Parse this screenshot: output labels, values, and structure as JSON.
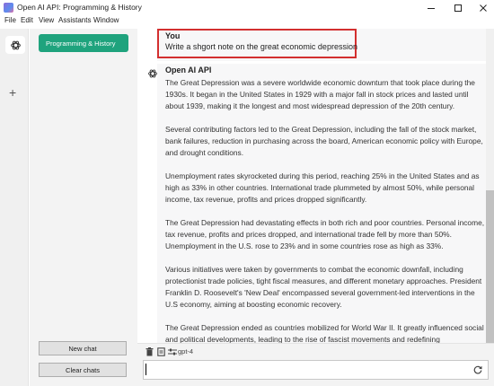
{
  "window": {
    "title": "Open AI API: Programming & History"
  },
  "menu": [
    "File",
    "Edit",
    "View",
    "Assistants",
    "Window"
  ],
  "sidebar": {
    "chats": [
      "Programming & History"
    ],
    "new_chat_label": "New chat",
    "clear_chats_label": "Clear chats"
  },
  "conversation": {
    "user_name": "You",
    "user_message": "Write a shgort note on the great economic depression",
    "assistant_name": "Open AI API",
    "assistant_paragraphs": [
      "The Great Depression was a severe worldwide economic downturn that took place during the 1930s. It began in the United States in 1929 with a major fall in stock prices and lasted until about 1939, making it the longest and most widespread depression of the 20th century.",
      "Several contributing factors led to the Great Depression, including the fall of the stock market, bank failures, reduction in purchasing across the board, American economic policy with Europe, and drought conditions.",
      "Unemployment rates skyrocketed during this period, reaching 25% in the United States and as high as 33% in other countries. International trade plummeted by almost 50%, while personal income, tax revenue, profits and prices dropped significantly.",
      "The Great Depression had devastating effects in both rich and poor countries. Personal income, tax revenue, profits and prices dropped, and international trade fell by more than 50%. Unemployment in the U.S. rose to 23% and in some countries rose as high as 33%.",
      "Various initiatives were taken by governments to combat the economic downfall, including protectionist trade policies, tight fiscal measures, and different monetary approaches. President Franklin D. Roosevelt's 'New Deal' encompassed several government-led interventions in the U.S economy, aiming at boosting economic recovery.",
      "The Great Depression ended as countries mobilized for World War II. It greatly influenced social and political developments, leading to the rise of fascist movements and redefining"
    ]
  },
  "bottombar": {
    "model": "gpt-4",
    "prompt_value": ""
  },
  "colors": {
    "accent": "#1fa37d",
    "highlight_border": "#d32f2f"
  }
}
